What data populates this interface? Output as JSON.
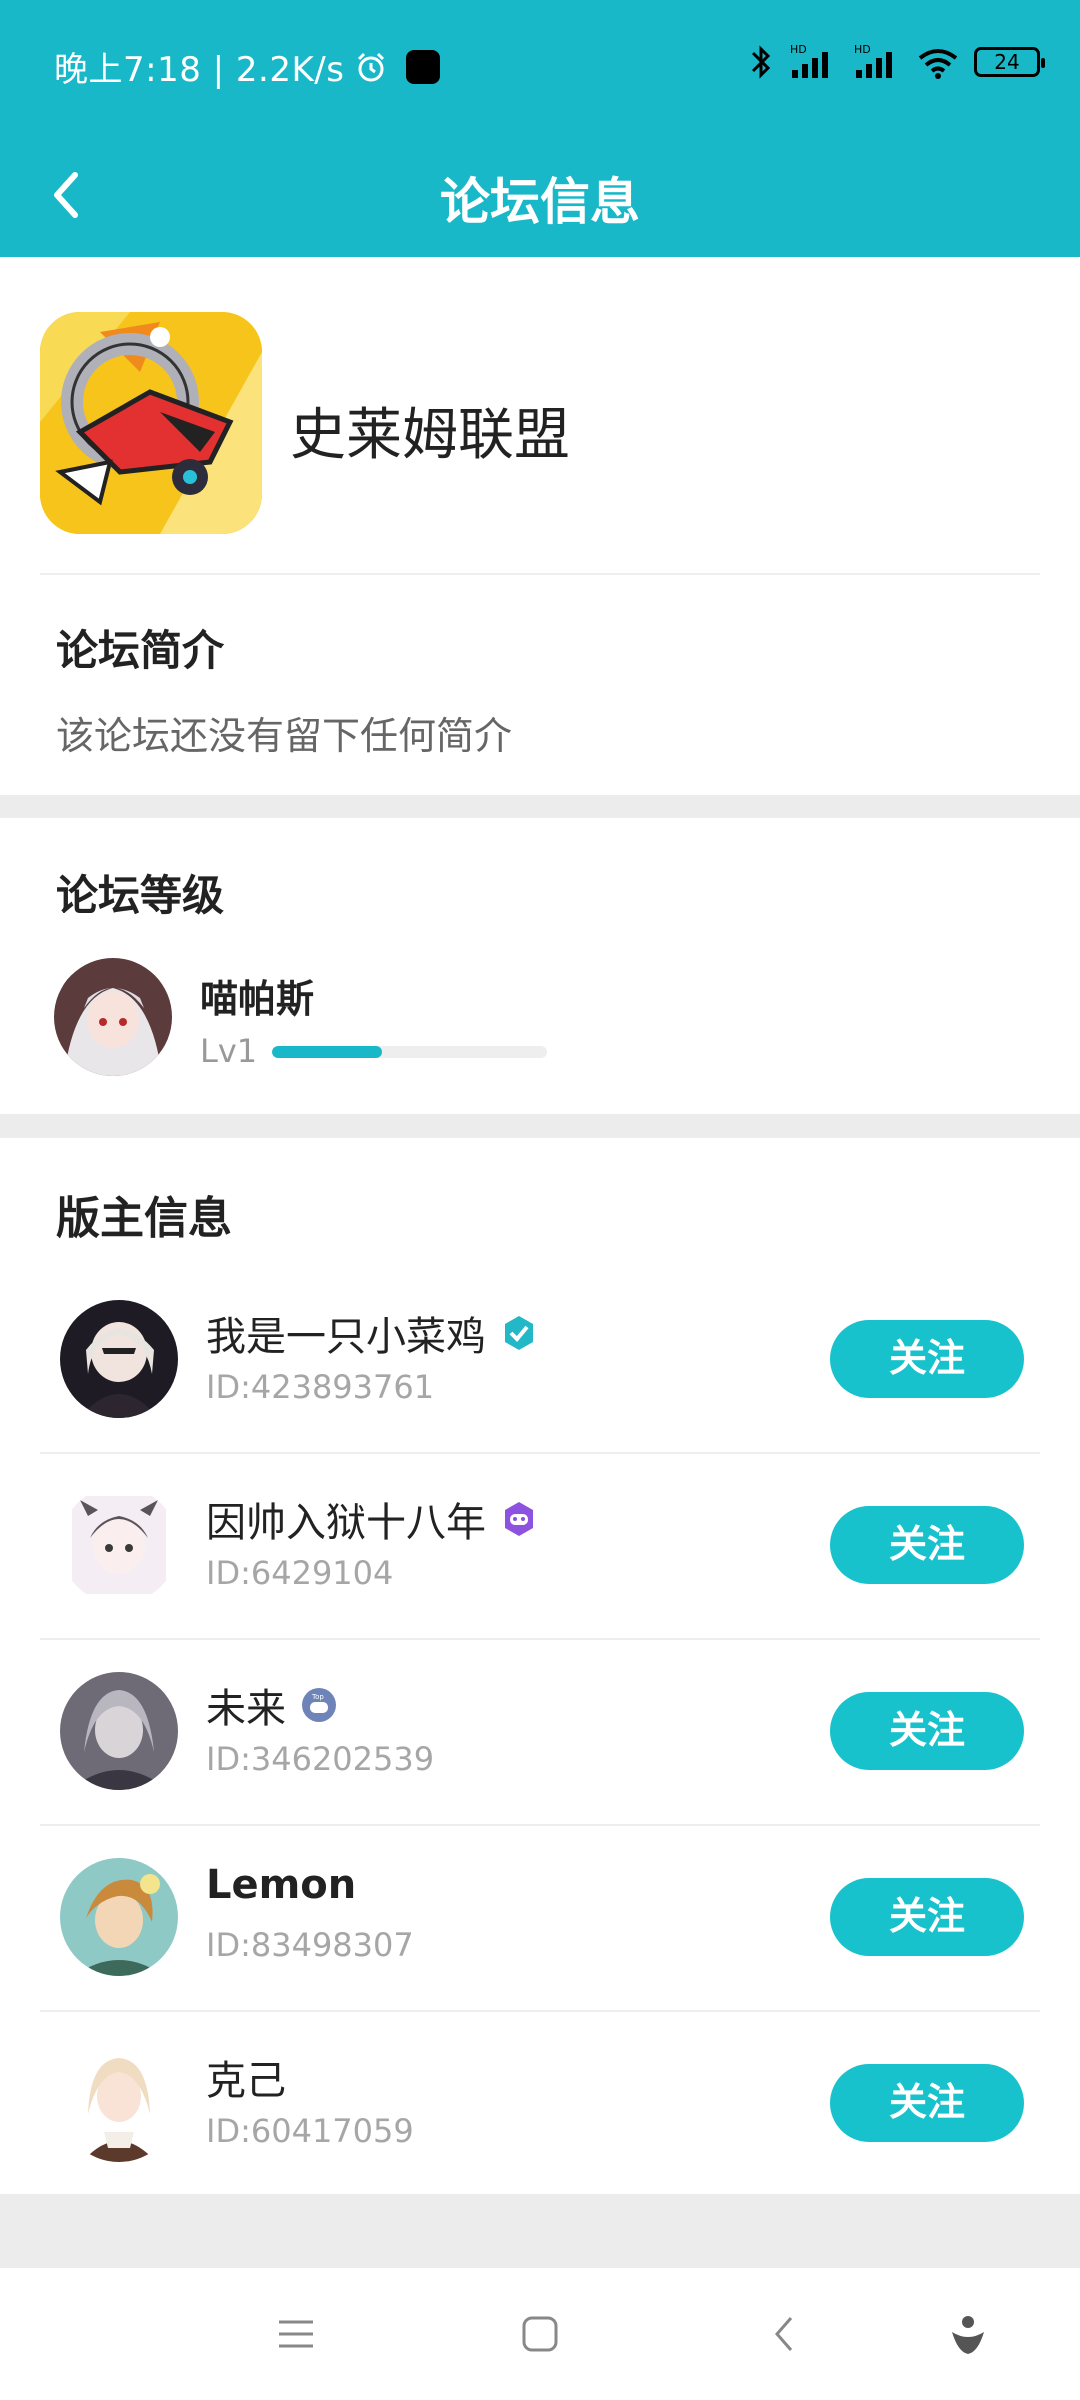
{
  "status_bar": {
    "left_text": "晚上7:18 | 2.2K/s",
    "battery": "24"
  },
  "header": {
    "title": "论坛信息"
  },
  "forum": {
    "name": "史莱姆联盟",
    "intro_title": "论坛简介",
    "intro_text": "该论坛还没有留下任何简介"
  },
  "level": {
    "title": "论坛等级",
    "user_name": "喵帕斯",
    "level_label": "Lv1",
    "progress_fraction": 0.4
  },
  "moderators": {
    "title": "版主信息",
    "follow_label": "关注",
    "items": [
      {
        "name": "我是一只小菜鸡",
        "id": "ID:423893761",
        "badge": "verified-check-icon"
      },
      {
        "name": "因帅入狱十八年",
        "id": "ID:6429104",
        "badge": "gamepad-badge-icon"
      },
      {
        "name": "未来",
        "id": "ID:346202539",
        "badge": "top-gamepad-badge-icon"
      },
      {
        "name": "Lemon",
        "id": "ID:83498307",
        "badge": ""
      },
      {
        "name": "克己",
        "id": "ID:60417059",
        "badge": ""
      }
    ]
  },
  "colors": {
    "accent": "#18b8c8",
    "button": "#18c2cc"
  }
}
